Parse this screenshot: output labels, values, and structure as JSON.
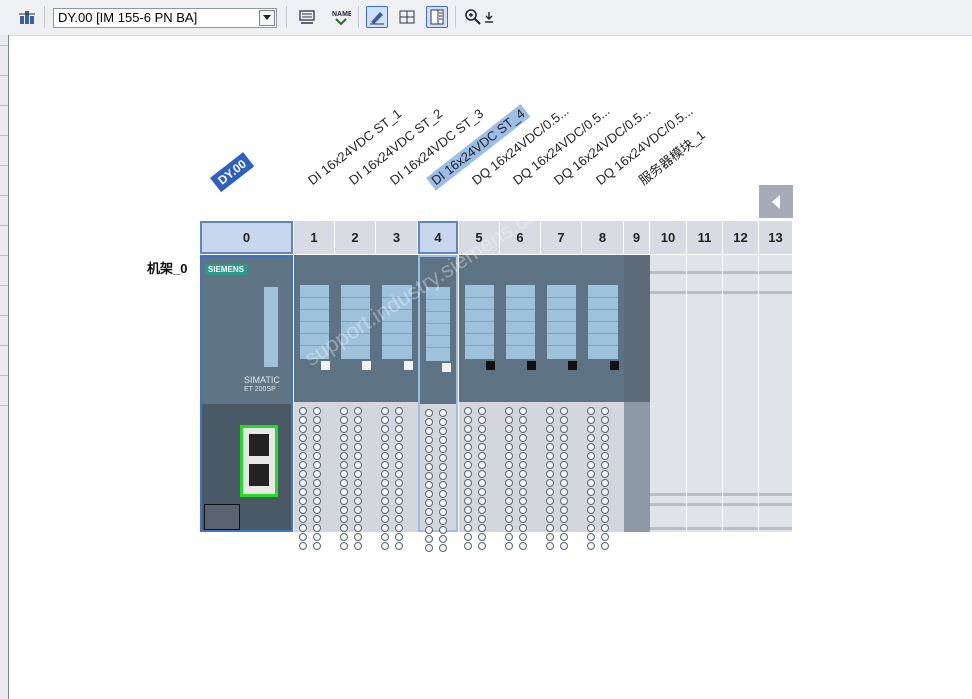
{
  "toolbar": {
    "device_select_value": "DY.00 [IM 155-6 PN BA]",
    "icons": [
      "network-icon",
      "slot-overview-icon",
      "name-icon",
      "edit-icon",
      "grid-icon",
      "layout-icon",
      "zoom-icon"
    ]
  },
  "device_label": "DY.00",
  "rack_label": "机架_0",
  "module_labels": [
    "DI 16x24VDC ST_1",
    "DI 16x24VDC ST_2",
    "DI 16x24VDC ST_3",
    "DI 16x24VDC ST_4",
    "DQ 16x24VDC/0.5...",
    "DQ 16x24VDC/0.5...",
    "DQ 16x24VDC/0.5...",
    "DQ 16x24VDC/0.5...",
    "服务器模块_1"
  ],
  "slots": [
    "0",
    "1",
    "2",
    "3",
    "4",
    "5",
    "6",
    "7",
    "8",
    "9",
    "10",
    "11",
    "12",
    "13"
  ],
  "head_module": {
    "brand": "SIEMENS",
    "model": "SIMATIC",
    "series": "ET 200SP"
  },
  "colors": {
    "selection": "#9cbde6",
    "device_badge": "#2f5fc0",
    "port_highlight": "#22dd22"
  },
  "watermark": "support.industry.siemens.com/cs"
}
